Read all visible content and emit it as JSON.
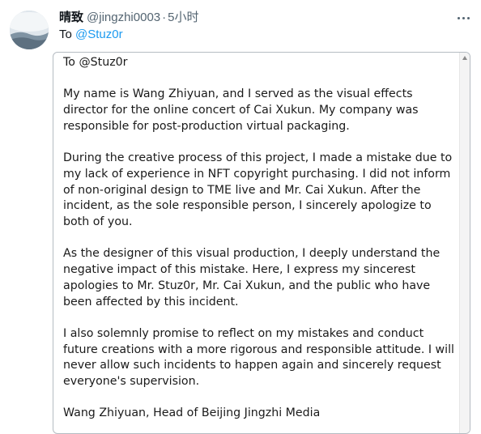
{
  "tweet": {
    "display_name": "晴致",
    "handle": "@jingzhi0003",
    "separator": "·",
    "time": "5小时",
    "reply_prefix": "To",
    "reply_mention": "@Stuz0r"
  },
  "document": {
    "salutation": "To @Stuz0r",
    "paragraphs": [
      "My name is Wang Zhiyuan, and I served as the visual effects director for the online concert of Cai Xukun. My company was responsible for post-production virtual packaging.",
      "During the creative process of this project, I made a mistake due to my lack of experience in NFT copyright purchasing. I did not inform of non-original design to TME live and Mr. Cai Xukun. After the incident, as the sole responsible person, I sincerely apologize to both of you.",
      "As the designer of this visual production, I deeply understand the negative impact of this mistake. Here, I express my sincerest apologies to Mr. Stuz0r, Mr. Cai Xukun, and the public who have been affected by this incident.",
      "I also solemnly promise to reflect on my mistakes and conduct future creations with a more rigorous and responsible attitude. I will never allow such incidents to happen again and sincerely request everyone's supervision."
    ],
    "signature": "Wang Zhiyuan, Head of Beijing Jingzhi Media"
  },
  "icons": {
    "more": "more-horizontal-icon",
    "scroll_up": "scroll-up-arrow-icon"
  }
}
